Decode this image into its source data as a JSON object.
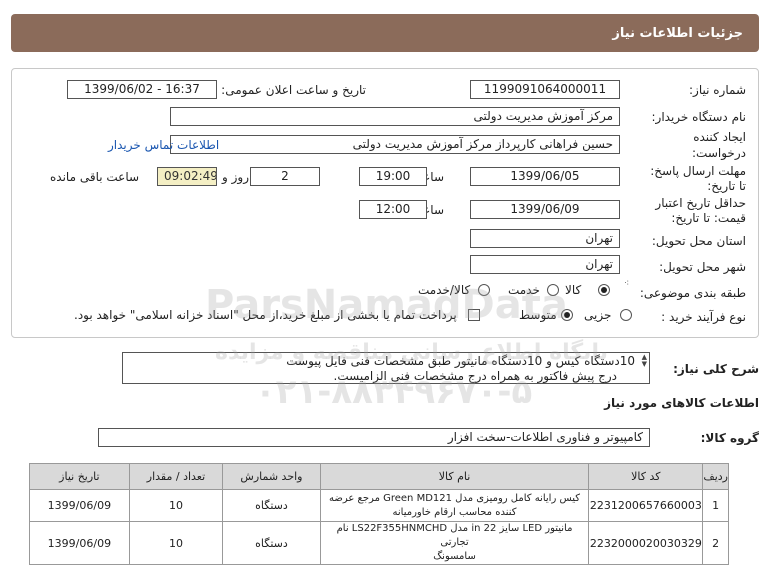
{
  "header": {
    "title": "جزئیات اطلاعات نیاز"
  },
  "form": {
    "need_number_label": "شماره نیاز:",
    "need_number": "1199091064000011",
    "announce_label": "تاریخ و ساعت اعلان عمومی:",
    "announce_value": "1399/06/02 - 16:37",
    "buyer_label": "نام دستگاه خریدار:",
    "buyer_value": "مرکز آموزش مدیریت دولتی",
    "creator_label_1": "ایجاد کننده",
    "creator_label_2": "درخواست:",
    "creator_value": "حسین  فراهانی کارپرداز مرکز آموزش مدیریت دولتی",
    "contact_link": "اطلاعات تماس خریدار",
    "reply_label_1": "مهلت ارسال پاسخ:",
    "reply_label_2": "تا تاریخ:",
    "reply_date": "1399/06/05",
    "time_label": "ساعت",
    "reply_time": "19:00",
    "days_value": "2",
    "days_label": "روز و",
    "remaining_value": "09:02:49",
    "remaining_label": "ساعت باقی مانده",
    "validity_label_1": "حداقل تاریخ اعتبار",
    "validity_label_2": "قیمت: تا تاریخ:",
    "validity_date": "1399/06/09",
    "validity_time": "12:00",
    "province_label": "استان محل تحویل:",
    "province_value": "تهران",
    "city_label": "شهر محل تحویل:",
    "city_value": "تهران",
    "category_label": "طبقه بندی موضوعی:",
    "category_options": [
      "کالا",
      "خدمت",
      "کالا/خدمت"
    ],
    "process_label": "نوع فرآیند خرید :",
    "process_options": [
      "جزیی",
      "متوسط"
    ],
    "payment_note": "پرداخت تمام یا بخشی از مبلغ خرید،از محل \"اسناد خزانه اسلامی\" خواهد بود."
  },
  "description": {
    "label": "شرح کلی نیاز:",
    "line1": "10دستگاه کیس و 10دستگاه مانیتور طبق مشخصات فنی فایل پیوست",
    "line2": "درج پیش فاکتور به همراه درج مشخصات فنی الزامیست."
  },
  "goods": {
    "section_title": "اطلاعات کالاهای مورد نیاز",
    "group_label": "گروه کالا:",
    "group_value": "کامپیوتر و فناوری اطلاعات-سخت افزار",
    "columns": [
      "ردیف",
      "کد کالا",
      "نام کالا",
      "واحد شمارش",
      "تعداد / مقدار",
      "تاریخ نیاز"
    ],
    "rows": [
      {
        "row": "1",
        "code": "2231200657660003",
        "name1": "کیس رایانه کامل رومیزی مدل Green MD121 مرجع عرضه",
        "name2": "کننده محاسب ارقام خاورمیانه",
        "unit": "دستگاه",
        "qty": "10",
        "date": "1399/06/09"
      },
      {
        "row": "2",
        "code": "2232000020030329",
        "name1": "مانیتور LED سایز 22 in مدل LS22F355HNMCHD نام تجارتی",
        "name2": "سامسونگ",
        "unit": "دستگاه",
        "qty": "10",
        "date": "1399/06/09"
      }
    ]
  },
  "watermark": {
    "brand": "ParsNamadData",
    "tagline": "پایگاه اطلاع رسانی مناقصه و مزایده",
    "phone": "۰۲۱-۸۸۳۴۹۶۷۰-۵"
  }
}
